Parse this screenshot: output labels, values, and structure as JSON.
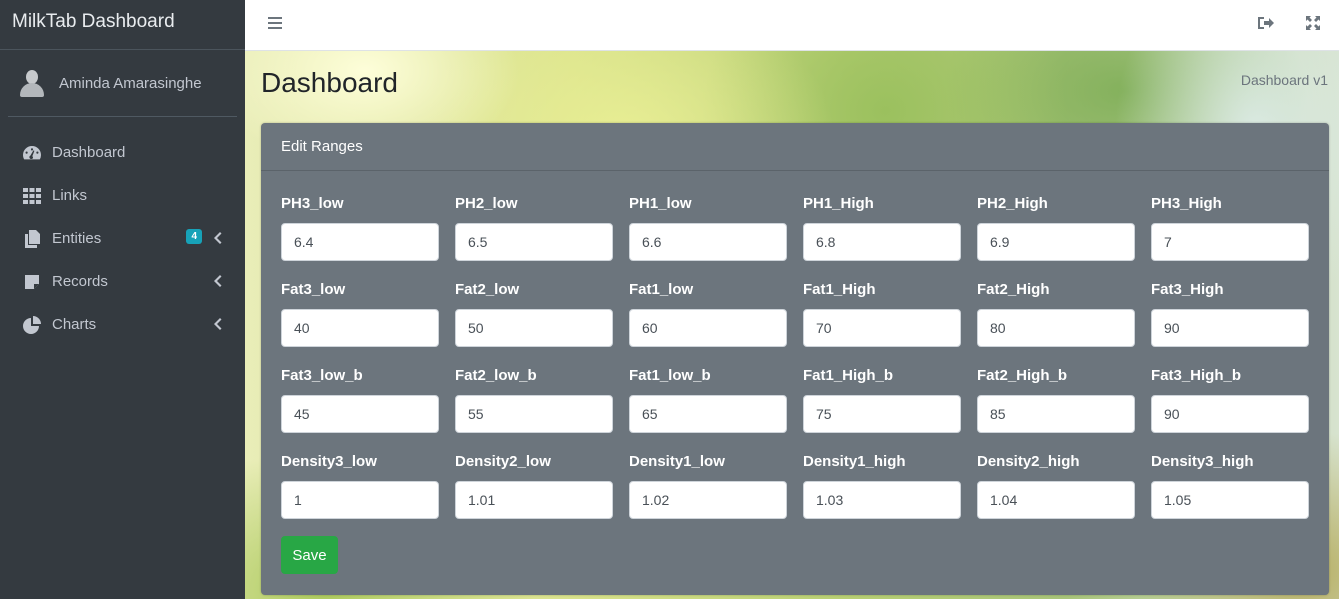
{
  "app": {
    "title": "MilkTab Dashboard"
  },
  "user": {
    "name": "Aminda Amarasinghe"
  },
  "sidebar": {
    "items": [
      {
        "label": "Dashboard",
        "icon": "tachometer-icon"
      },
      {
        "label": "Links",
        "icon": "grid-icon"
      },
      {
        "label": "Entities",
        "icon": "copy-icon",
        "badge": "4",
        "expandable": true
      },
      {
        "label": "Records",
        "icon": "sticky-note-icon",
        "expandable": true
      },
      {
        "label": "Charts",
        "icon": "pie-chart-icon",
        "expandable": true
      }
    ]
  },
  "topbar": {
    "icons": [
      "menu-icon",
      "sign-out-icon",
      "fullscreen-icon"
    ]
  },
  "page": {
    "title": "Dashboard",
    "breadcrumb": "Dashboard v1"
  },
  "form": {
    "title": "Edit Ranges",
    "rows": [
      [
        {
          "label": "PH3_low",
          "value": "6.4"
        },
        {
          "label": "PH2_low",
          "value": "6.5"
        },
        {
          "label": "PH1_low",
          "value": "6.6"
        },
        {
          "label": "PH1_High",
          "value": "6.8"
        },
        {
          "label": "PH2_High",
          "value": "6.9"
        },
        {
          "label": "PH3_High",
          "value": "7"
        }
      ],
      [
        {
          "label": "Fat3_low",
          "value": "40"
        },
        {
          "label": "Fat2_low",
          "value": "50"
        },
        {
          "label": "Fat1_low",
          "value": "60"
        },
        {
          "label": "Fat1_High",
          "value": "70"
        },
        {
          "label": "Fat2_High",
          "value": "80"
        },
        {
          "label": "Fat3_High",
          "value": "90"
        }
      ],
      [
        {
          "label": "Fat3_low_b",
          "value": "45"
        },
        {
          "label": "Fat2_low_b",
          "value": "55"
        },
        {
          "label": "Fat1_low_b",
          "value": "65"
        },
        {
          "label": "Fat1_High_b",
          "value": "75"
        },
        {
          "label": "Fat2_High_b",
          "value": "85"
        },
        {
          "label": "Fat3_High_b",
          "value": "90"
        }
      ],
      [
        {
          "label": "Density3_low",
          "value": "1"
        },
        {
          "label": "Density2_low",
          "value": "1.01"
        },
        {
          "label": "Density1_low",
          "value": "1.02"
        },
        {
          "label": "Density1_high",
          "value": "1.03"
        },
        {
          "label": "Density2_high",
          "value": "1.04"
        },
        {
          "label": "Density3_high",
          "value": "1.05"
        }
      ]
    ],
    "save_label": "Save"
  },
  "colors": {
    "sidebar": "#343a40",
    "card": "#6c757d",
    "save": "#28a745",
    "badge": "#17a2b8"
  }
}
